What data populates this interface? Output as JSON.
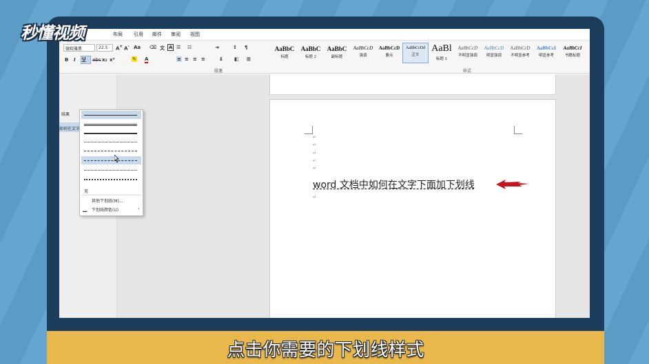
{
  "watermark": {
    "logo": "秒懂视频"
  },
  "ribbon": {
    "menus": [
      "布局",
      "引用",
      "邮件",
      "审阅",
      "视图"
    ],
    "font_name": "微软雅黑",
    "font_size": "22.5",
    "group_paragraph": "段落",
    "group_styles": "样式",
    "styles": [
      {
        "preview": "AaBbC",
        "name": "标题"
      },
      {
        "preview": "AaBbC",
        "name": "标题 2"
      },
      {
        "preview": "AaBbC",
        "name": "副标题"
      },
      {
        "preview": "AaBbCcD",
        "name": "强调"
      },
      {
        "preview": "AaBbCcD",
        "name": "要点"
      },
      {
        "preview": "AaBbCcDd",
        "name": "正文"
      },
      {
        "preview": "AaBl",
        "name": "标题 1"
      },
      {
        "preview": "AaBbCcD",
        "name": "不明显强调"
      },
      {
        "preview": "AaBbCcD",
        "name": "明显强调"
      },
      {
        "preview": "AaBbCcD",
        "name": "不明显参考"
      },
      {
        "preview": "AaBbCcI",
        "name": "明显参考"
      },
      {
        "preview": "AaBbCcI",
        "name": "书籍标题"
      }
    ]
  },
  "nav_pane": {
    "results_label": "结果",
    "item": "如何在文字"
  },
  "underline_menu": {
    "none_label": "无",
    "more_label": "其他下划线(M)...",
    "color_label": "下划线颜色(U)"
  },
  "document": {
    "text": "word 文档中如何在文字下面加下划线"
  },
  "colors": {
    "arrow": "#c9141b",
    "caption_bg": "#e8b84d"
  },
  "caption": {
    "text": "点击你需要的下划线样式"
  }
}
